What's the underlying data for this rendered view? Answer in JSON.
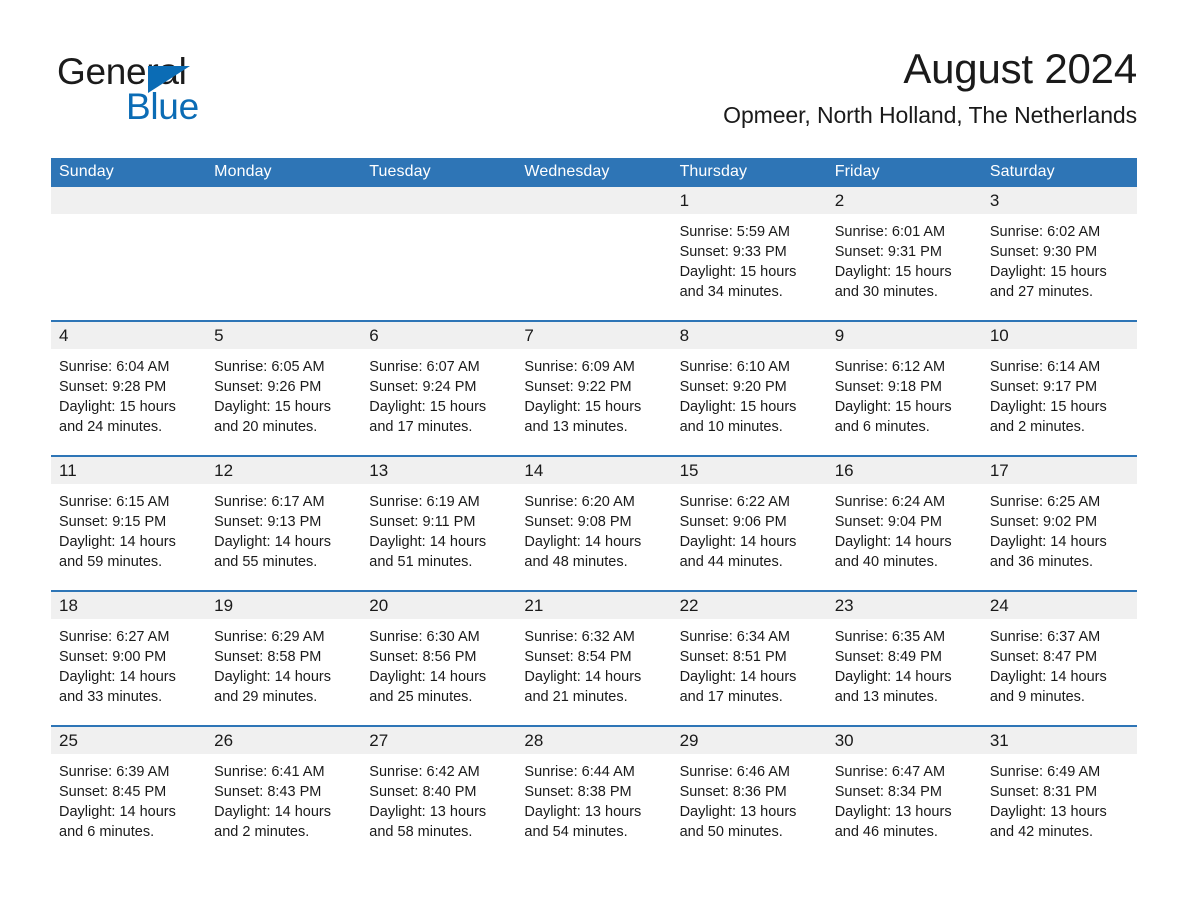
{
  "brand": {
    "name_part1": "General",
    "name_part2": "Blue",
    "accent_color": "#0b6cb5"
  },
  "header": {
    "title": "August 2024",
    "subtitle": "Opmeer, North Holland, The Netherlands"
  },
  "theme": {
    "header_blue": "#2e75b6",
    "date_band_gray": "#f0f0f0",
    "text": "#1a1a1a"
  },
  "calendar": {
    "weekday_headers": [
      "Sunday",
      "Monday",
      "Tuesday",
      "Wednesday",
      "Thursday",
      "Friday",
      "Saturday"
    ],
    "weeks": [
      [
        {
          "day": "",
          "sunrise": "",
          "sunset": "",
          "daylight_line1": "",
          "daylight_line2": "",
          "empty": true
        },
        {
          "day": "",
          "sunrise": "",
          "sunset": "",
          "daylight_line1": "",
          "daylight_line2": "",
          "empty": true
        },
        {
          "day": "",
          "sunrise": "",
          "sunset": "",
          "daylight_line1": "",
          "daylight_line2": "",
          "empty": true
        },
        {
          "day": "",
          "sunrise": "",
          "sunset": "",
          "daylight_line1": "",
          "daylight_line2": "",
          "empty": true
        },
        {
          "day": "1",
          "sunrise": "Sunrise: 5:59 AM",
          "sunset": "Sunset: 9:33 PM",
          "daylight_line1": "Daylight: 15 hours",
          "daylight_line2": "and 34 minutes."
        },
        {
          "day": "2",
          "sunrise": "Sunrise: 6:01 AM",
          "sunset": "Sunset: 9:31 PM",
          "daylight_line1": "Daylight: 15 hours",
          "daylight_line2": "and 30 minutes."
        },
        {
          "day": "3",
          "sunrise": "Sunrise: 6:02 AM",
          "sunset": "Sunset: 9:30 PM",
          "daylight_line1": "Daylight: 15 hours",
          "daylight_line2": "and 27 minutes."
        }
      ],
      [
        {
          "day": "4",
          "sunrise": "Sunrise: 6:04 AM",
          "sunset": "Sunset: 9:28 PM",
          "daylight_line1": "Daylight: 15 hours",
          "daylight_line2": "and 24 minutes."
        },
        {
          "day": "5",
          "sunrise": "Sunrise: 6:05 AM",
          "sunset": "Sunset: 9:26 PM",
          "daylight_line1": "Daylight: 15 hours",
          "daylight_line2": "and 20 minutes."
        },
        {
          "day": "6",
          "sunrise": "Sunrise: 6:07 AM",
          "sunset": "Sunset: 9:24 PM",
          "daylight_line1": "Daylight: 15 hours",
          "daylight_line2": "and 17 minutes."
        },
        {
          "day": "7",
          "sunrise": "Sunrise: 6:09 AM",
          "sunset": "Sunset: 9:22 PM",
          "daylight_line1": "Daylight: 15 hours",
          "daylight_line2": "and 13 minutes."
        },
        {
          "day": "8",
          "sunrise": "Sunrise: 6:10 AM",
          "sunset": "Sunset: 9:20 PM",
          "daylight_line1": "Daylight: 15 hours",
          "daylight_line2": "and 10 minutes."
        },
        {
          "day": "9",
          "sunrise": "Sunrise: 6:12 AM",
          "sunset": "Sunset: 9:18 PM",
          "daylight_line1": "Daylight: 15 hours",
          "daylight_line2": "and 6 minutes."
        },
        {
          "day": "10",
          "sunrise": "Sunrise: 6:14 AM",
          "sunset": "Sunset: 9:17 PM",
          "daylight_line1": "Daylight: 15 hours",
          "daylight_line2": "and 2 minutes."
        }
      ],
      [
        {
          "day": "11",
          "sunrise": "Sunrise: 6:15 AM",
          "sunset": "Sunset: 9:15 PM",
          "daylight_line1": "Daylight: 14 hours",
          "daylight_line2": "and 59 minutes."
        },
        {
          "day": "12",
          "sunrise": "Sunrise: 6:17 AM",
          "sunset": "Sunset: 9:13 PM",
          "daylight_line1": "Daylight: 14 hours",
          "daylight_line2": "and 55 minutes."
        },
        {
          "day": "13",
          "sunrise": "Sunrise: 6:19 AM",
          "sunset": "Sunset: 9:11 PM",
          "daylight_line1": "Daylight: 14 hours",
          "daylight_line2": "and 51 minutes."
        },
        {
          "day": "14",
          "sunrise": "Sunrise: 6:20 AM",
          "sunset": "Sunset: 9:08 PM",
          "daylight_line1": "Daylight: 14 hours",
          "daylight_line2": "and 48 minutes."
        },
        {
          "day": "15",
          "sunrise": "Sunrise: 6:22 AM",
          "sunset": "Sunset: 9:06 PM",
          "daylight_line1": "Daylight: 14 hours",
          "daylight_line2": "and 44 minutes."
        },
        {
          "day": "16",
          "sunrise": "Sunrise: 6:24 AM",
          "sunset": "Sunset: 9:04 PM",
          "daylight_line1": "Daylight: 14 hours",
          "daylight_line2": "and 40 minutes."
        },
        {
          "day": "17",
          "sunrise": "Sunrise: 6:25 AM",
          "sunset": "Sunset: 9:02 PM",
          "daylight_line1": "Daylight: 14 hours",
          "daylight_line2": "and 36 minutes."
        }
      ],
      [
        {
          "day": "18",
          "sunrise": "Sunrise: 6:27 AM",
          "sunset": "Sunset: 9:00 PM",
          "daylight_line1": "Daylight: 14 hours",
          "daylight_line2": "and 33 minutes."
        },
        {
          "day": "19",
          "sunrise": "Sunrise: 6:29 AM",
          "sunset": "Sunset: 8:58 PM",
          "daylight_line1": "Daylight: 14 hours",
          "daylight_line2": "and 29 minutes."
        },
        {
          "day": "20",
          "sunrise": "Sunrise: 6:30 AM",
          "sunset": "Sunset: 8:56 PM",
          "daylight_line1": "Daylight: 14 hours",
          "daylight_line2": "and 25 minutes."
        },
        {
          "day": "21",
          "sunrise": "Sunrise: 6:32 AM",
          "sunset": "Sunset: 8:54 PM",
          "daylight_line1": "Daylight: 14 hours",
          "daylight_line2": "and 21 minutes."
        },
        {
          "day": "22",
          "sunrise": "Sunrise: 6:34 AM",
          "sunset": "Sunset: 8:51 PM",
          "daylight_line1": "Daylight: 14 hours",
          "daylight_line2": "and 17 minutes."
        },
        {
          "day": "23",
          "sunrise": "Sunrise: 6:35 AM",
          "sunset": "Sunset: 8:49 PM",
          "daylight_line1": "Daylight: 14 hours",
          "daylight_line2": "and 13 minutes."
        },
        {
          "day": "24",
          "sunrise": "Sunrise: 6:37 AM",
          "sunset": "Sunset: 8:47 PM",
          "daylight_line1": "Daylight: 14 hours",
          "daylight_line2": "and 9 minutes."
        }
      ],
      [
        {
          "day": "25",
          "sunrise": "Sunrise: 6:39 AM",
          "sunset": "Sunset: 8:45 PM",
          "daylight_line1": "Daylight: 14 hours",
          "daylight_line2": "and 6 minutes."
        },
        {
          "day": "26",
          "sunrise": "Sunrise: 6:41 AM",
          "sunset": "Sunset: 8:43 PM",
          "daylight_line1": "Daylight: 14 hours",
          "daylight_line2": "and 2 minutes."
        },
        {
          "day": "27",
          "sunrise": "Sunrise: 6:42 AM",
          "sunset": "Sunset: 8:40 PM",
          "daylight_line1": "Daylight: 13 hours",
          "daylight_line2": "and 58 minutes."
        },
        {
          "day": "28",
          "sunrise": "Sunrise: 6:44 AM",
          "sunset": "Sunset: 8:38 PM",
          "daylight_line1": "Daylight: 13 hours",
          "daylight_line2": "and 54 minutes."
        },
        {
          "day": "29",
          "sunrise": "Sunrise: 6:46 AM",
          "sunset": "Sunset: 8:36 PM",
          "daylight_line1": "Daylight: 13 hours",
          "daylight_line2": "and 50 minutes."
        },
        {
          "day": "30",
          "sunrise": "Sunrise: 6:47 AM",
          "sunset": "Sunset: 8:34 PM",
          "daylight_line1": "Daylight: 13 hours",
          "daylight_line2": "and 46 minutes."
        },
        {
          "day": "31",
          "sunrise": "Sunrise: 6:49 AM",
          "sunset": "Sunset: 8:31 PM",
          "daylight_line1": "Daylight: 13 hours",
          "daylight_line2": "and 42 minutes."
        }
      ]
    ]
  }
}
